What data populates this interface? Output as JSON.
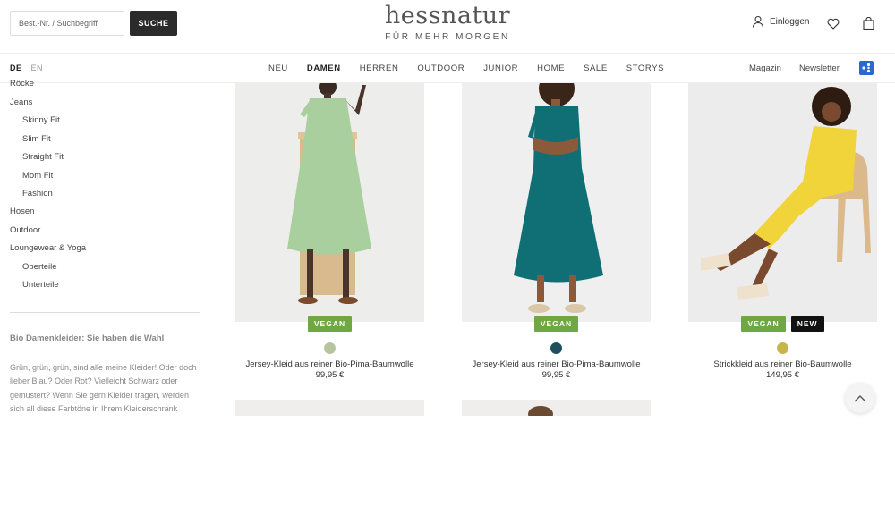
{
  "header": {
    "search_placeholder": "Best.-Nr. / Suchbegriff",
    "search_button": "SUCHE",
    "logo_word": "hessnatur",
    "logo_tagline": "FÜR MEHR MORGEN",
    "login_label": "Einloggen"
  },
  "nav": {
    "lang_de": "DE",
    "lang_en": "EN",
    "items": [
      "NEU",
      "DAMEN",
      "HERREN",
      "OUTDOOR",
      "JUNIOR",
      "HOME",
      "SALE",
      "STORYS"
    ],
    "magazin": "Magazin",
    "newsletter": "Newsletter"
  },
  "sidebar": {
    "items": [
      "Röcke",
      "Jeans",
      "Skinny Fit",
      "Slim Fit",
      "Straight Fit",
      "Mom Fit",
      "Fashion",
      "Hosen",
      "Outdoor",
      "Loungewear & Yoga",
      "Oberteile",
      "Unterteile"
    ],
    "seo_title": "Bio Damenkleider: Sie haben die Wahl",
    "seo_text": "Grün, grün, grün, sind alle meine Kleider! Oder doch lieber Blau? Oder Rot? Vielleicht Schwarz oder gemustert? Wenn Sie gern Kleider tragen, werden sich all diese Farbtöne in Ihrem Kleiderschrank"
  },
  "products": [
    {
      "name": "Jersey-Kleid aus reiner Bio-Pima-Baumwolle",
      "price": "99,95 €",
      "badge_vegan": "VEGAN",
      "swatch": "#b7c4a0",
      "dress_color": "#a9cf9f"
    },
    {
      "name": "Jersey-Kleid aus reiner Bio-Pima-Baumwolle",
      "price": "99,95 €",
      "badge_vegan": "VEGAN",
      "swatch": "#1f4f5c",
      "dress_color": "#0f6f74"
    },
    {
      "name": "Strickkleid aus reiner Bio-Baumwolle",
      "price": "149,95 €",
      "badge_vegan": "VEGAN",
      "badge_new": "NEW",
      "swatch": "#c9b44a",
      "dress_color": "#f0d43a"
    }
  ],
  "colors": {
    "accent_green": "#6fa843",
    "dark": "#2b2b2b",
    "social_blue": "#2a6ad0"
  }
}
